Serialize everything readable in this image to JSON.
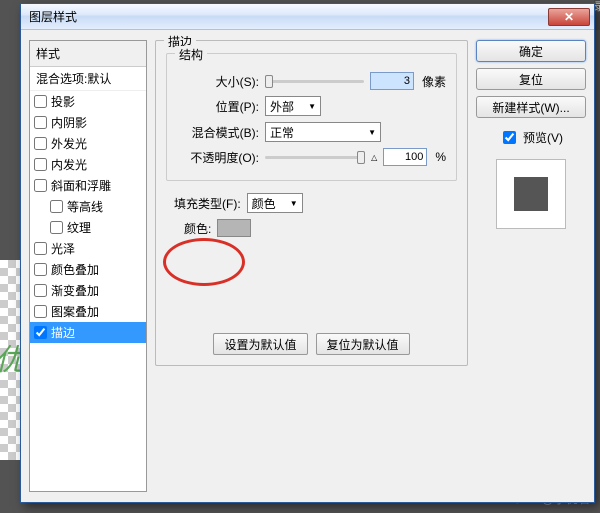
{
  "window": {
    "title": "图层样式",
    "close_glyph": "✕"
  },
  "sidebar_bg_label": "录",
  "watermark": "@小优君",
  "zhihu": "知乎",
  "bg_text": "优",
  "styles_panel": {
    "header": "样式",
    "blend_options": "混合选项:默认",
    "items": [
      {
        "label": "投影",
        "checked": false
      },
      {
        "label": "内阴影",
        "checked": false
      },
      {
        "label": "外发光",
        "checked": false
      },
      {
        "label": "内发光",
        "checked": false
      },
      {
        "label": "斜面和浮雕",
        "checked": false
      },
      {
        "label": "等高线",
        "checked": false,
        "indent": true
      },
      {
        "label": "纹理",
        "checked": false,
        "indent": true
      },
      {
        "label": "光泽",
        "checked": false
      },
      {
        "label": "颜色叠加",
        "checked": false
      },
      {
        "label": "渐变叠加",
        "checked": false
      },
      {
        "label": "图案叠加",
        "checked": false
      },
      {
        "label": "描边",
        "checked": true,
        "selected": true
      }
    ]
  },
  "center": {
    "group_stroke": "描边",
    "structure_title": "结构",
    "size_label": "大小(S):",
    "size_value": "3",
    "size_unit": "像素",
    "position_label": "位置(P):",
    "position_value": "外部",
    "blendmode_label": "混合模式(B):",
    "blendmode_value": "正常",
    "opacity_label": "不透明度(O):",
    "opacity_value": "100",
    "opacity_unit": "%",
    "filltype_label": "填充类型(F):",
    "filltype_value": "颜色",
    "color_label": "颜色:",
    "set_default": "设置为默认值",
    "reset_default": "复位为默认值"
  },
  "right": {
    "ok": "确定",
    "reset": "复位",
    "new_style": "新建样式(W)...",
    "preview_label": "预览(V)",
    "preview_checked": true
  }
}
